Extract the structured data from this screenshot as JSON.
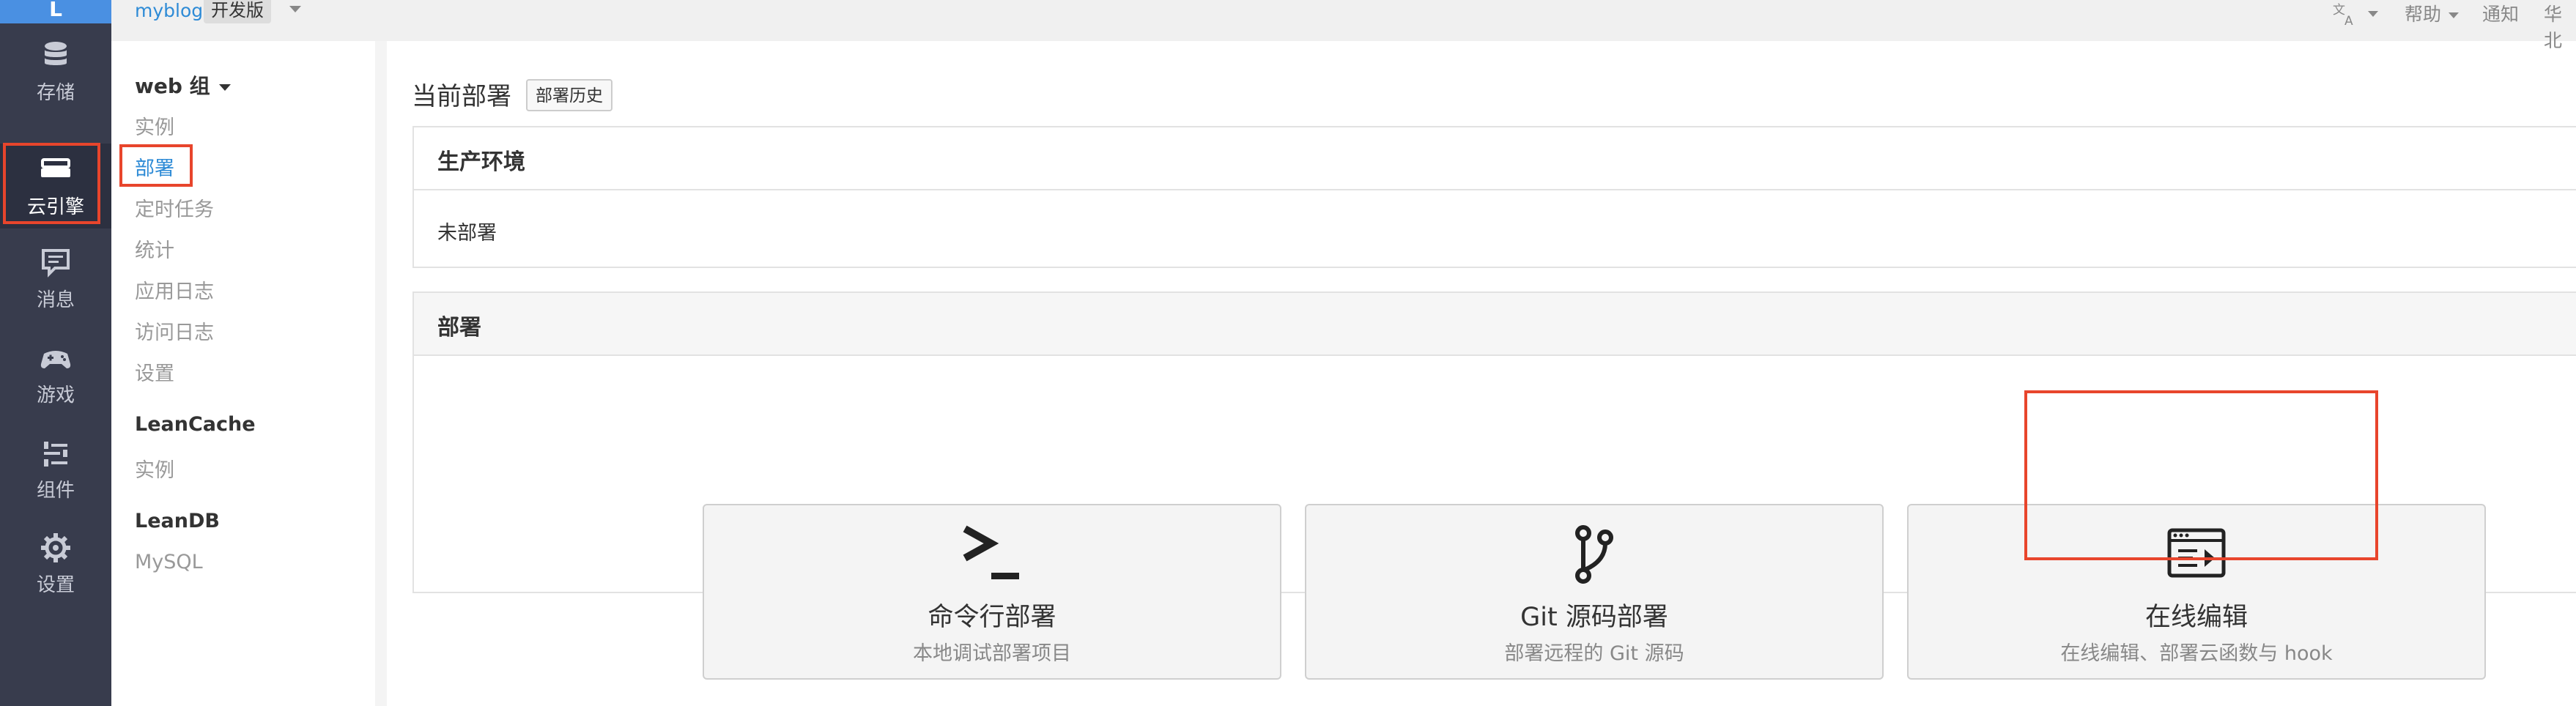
{
  "rail": {
    "logo": "L",
    "items": [
      {
        "label": "存储",
        "icon": "database-icon"
      },
      {
        "label": "云引擎",
        "icon": "server-icon"
      },
      {
        "label": "消息",
        "icon": "message-icon"
      },
      {
        "label": "游戏",
        "icon": "gamepad-icon"
      },
      {
        "label": "组件",
        "icon": "sliders-icon"
      },
      {
        "label": "设置",
        "icon": "gear-icon"
      }
    ]
  },
  "topbar": {
    "app_name": "myblog",
    "env_label": "开发版",
    "translate_icon": "translate-icon",
    "help_label": "帮助",
    "notify_label": "通知",
    "region_label": "华北"
  },
  "subnav": {
    "group_title": "web 组",
    "web_items": [
      "实例",
      "部署",
      "定时任务",
      "统计",
      "应用日志",
      "访问日志",
      "设置"
    ],
    "leancache_title": "LeanCache",
    "leancache_items": [
      "实例"
    ],
    "leandb_title": "LeanDB",
    "leandb_items": [
      "MySQL"
    ]
  },
  "main": {
    "title": "当前部署",
    "history_button": "部署历史",
    "production": {
      "title": "生产环境",
      "status": "未部署"
    },
    "deploy": {
      "title": "部署",
      "cards": [
        {
          "icon": "terminal-icon",
          "title": "命令行部署",
          "subtitle": "本地调试部署项目"
        },
        {
          "icon": "git-branch-icon",
          "title": "Git 源码部署",
          "subtitle": "部署远程的 Git 源码"
        },
        {
          "icon": "online-editor-icon",
          "title": "在线编辑",
          "subtitle": "在线编辑、部署云函数与 hook"
        }
      ]
    }
  },
  "colors": {
    "rail_bg": "#383c4d",
    "logo_bg": "#4a90e2",
    "link": "#2e8bd6",
    "highlight": "#e8452c"
  }
}
